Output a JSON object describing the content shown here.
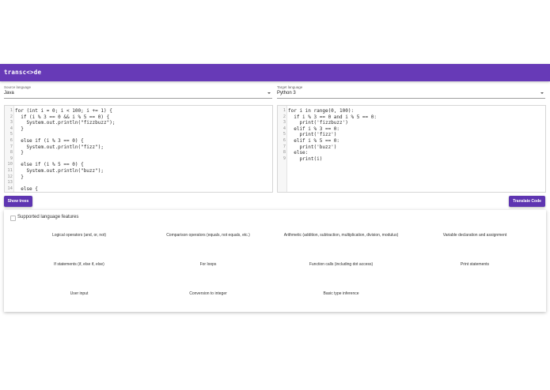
{
  "app": {
    "title": "transc<>de"
  },
  "source": {
    "label": "Source language",
    "value": "Java"
  },
  "target": {
    "label": "Target language",
    "value": "Python 3"
  },
  "source_code": [
    {
      "n": "1",
      "t": "for (int i = 0; i < 100; i += 1) {"
    },
    {
      "n": "2",
      "t": "  if (i % 3 == 0 && i % 5 == 0) {"
    },
    {
      "n": "3",
      "t": "    System.out.println(\"fizzbuzz\");"
    },
    {
      "n": "4",
      "t": "  }"
    },
    {
      "n": "5",
      "t": ""
    },
    {
      "n": "6",
      "t": "  else if (i % 3 == 0) {"
    },
    {
      "n": "7",
      "t": "    System.out.println(\"fizz\");"
    },
    {
      "n": "8",
      "t": "  }"
    },
    {
      "n": "9",
      "t": ""
    },
    {
      "n": "10",
      "t": "  else if (i % 5 == 0) {"
    },
    {
      "n": "11",
      "t": "    System.out.println(\"buzz\");"
    },
    {
      "n": "12",
      "t": "  }"
    },
    {
      "n": "13",
      "t": ""
    },
    {
      "n": "14",
      "t": "  else {"
    }
  ],
  "target_code": [
    {
      "n": "1",
      "t": "for i in range(0, 100):"
    },
    {
      "n": "2",
      "t": "  if i % 3 == 0 and i % 5 == 0:"
    },
    {
      "n": "3",
      "t": "    print('fizzbuzz')"
    },
    {
      "n": "4",
      "t": "  elif i % 3 == 0:"
    },
    {
      "n": "5",
      "t": "    print('fizz')"
    },
    {
      "n": "6",
      "t": "  elif i % 5 == 0:"
    },
    {
      "n": "7",
      "t": "    print('buzz')"
    },
    {
      "n": "8",
      "t": "  else:"
    },
    {
      "n": "9",
      "t": "    print(i)"
    }
  ],
  "buttons": {
    "show_trees": "Show trees",
    "translate": "Translate Code"
  },
  "features": {
    "heading": "Supported language features",
    "items": [
      "Logical operators (and, or, not)",
      "Comparison operators (equals, not equals, etc.)",
      "Arithmetic (addition, subtraction, multiplication, division, modulus)",
      "Variable declaration and assignment",
      "If statements (if, else if, else)",
      "For loops",
      "Function calls (including dot access)",
      "Print statements",
      "User input",
      "Conversion to integer",
      "Basic type inference"
    ]
  },
  "colors": {
    "primary": "#673ab7",
    "button": "#5e35b1"
  }
}
